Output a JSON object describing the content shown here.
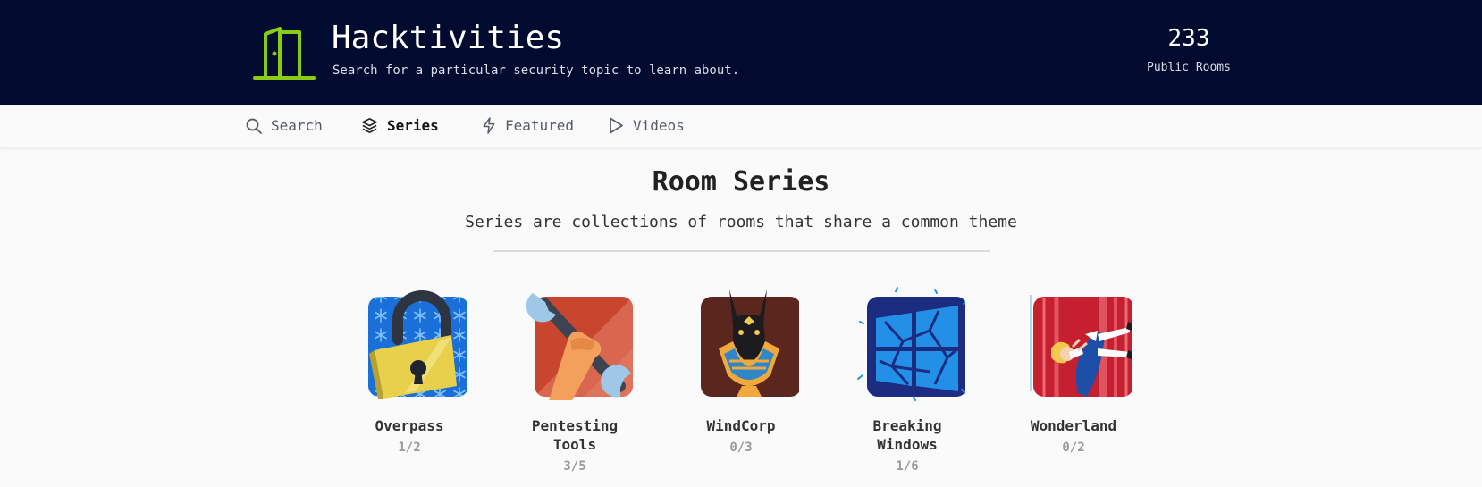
{
  "header": {
    "title": "Hacktivities",
    "subtitle": "Search for a particular security topic to learn about.",
    "rooms_count": "233",
    "rooms_label": "Public Rooms",
    "logo_icon": "door-icon",
    "accent_color": "#88cc14",
    "background_color": "#000b2f"
  },
  "nav": {
    "items": [
      {
        "label": "Search",
        "icon": "search-icon",
        "active": false
      },
      {
        "label": "Series",
        "icon": "layers-icon",
        "active": true
      },
      {
        "label": "Featured",
        "icon": "lightning-icon",
        "active": false
      },
      {
        "label": "Videos",
        "icon": "play-icon",
        "active": false
      }
    ]
  },
  "section": {
    "title": "Room Series",
    "subtitle": "Series are collections of rooms that share a common theme"
  },
  "series": [
    {
      "name": "Overpass",
      "progress": "1/2",
      "icon": "padlock-icon"
    },
    {
      "name": "Pentesting Tools",
      "progress": "3/5",
      "icon": "wrench-icon"
    },
    {
      "name": "WindCorp",
      "progress": "0/3",
      "icon": "anubis-icon"
    },
    {
      "name": "Breaking Windows",
      "progress": "1/6",
      "icon": "broken-windows-icon"
    },
    {
      "name": "Wonderland",
      "progress": "0/2",
      "icon": "falling-alice-icon"
    }
  ]
}
